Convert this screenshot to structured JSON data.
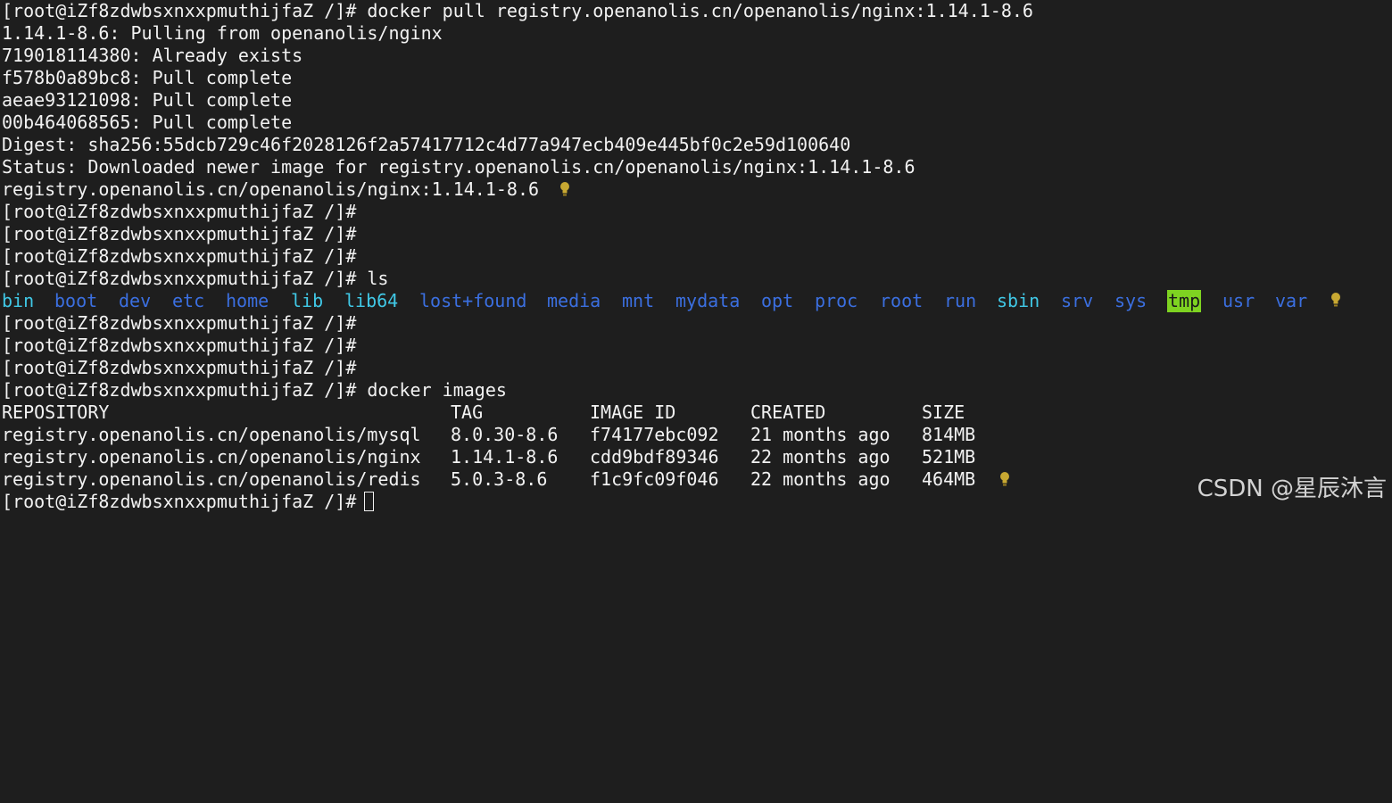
{
  "terminal": {
    "lines": [
      "[root@iZf8zdwbsxnxxpmuthijfaZ /]# docker pull registry.openanolis.cn/openanolis/nginx:1.14.1-8.6",
      "1.14.1-8.6: Pulling from openanolis/nginx",
      "719018114380: Already exists",
      "f578b0a89bc8: Pull complete",
      "aeae93121098: Pull complete",
      "00b464068565: Pull complete",
      "Digest: sha256:55dcb729c46f2028126f2a57417712c4d77a947ecb409e445bf0c2e59d100640",
      "Status: Downloaded newer image for registry.openanolis.cn/openanolis/nginx:1.14.1-8.6",
      "registry.openanolis.cn/openanolis/nginx:1.14.1-8.6",
      "[root@iZf8zdwbsxnxxpmuthijfaZ /]#",
      "[root@iZf8zdwbsxnxxpmuthijfaZ /]#",
      "[root@iZf8zdwbsxnxxpmuthijfaZ /]#",
      "[root@iZf8zdwbsxnxxpmuthijfaZ /]# ls"
    ],
    "ls_entries": [
      {
        "name": "bin",
        "color": "#40c8e6",
        "highlight": false
      },
      {
        "name": "boot",
        "color": "#3b6fe0",
        "highlight": false
      },
      {
        "name": "dev",
        "color": "#3b6fe0",
        "highlight": false
      },
      {
        "name": "etc",
        "color": "#3b6fe0",
        "highlight": false
      },
      {
        "name": "home",
        "color": "#3b6fe0",
        "highlight": false
      },
      {
        "name": "lib",
        "color": "#40c8e6",
        "highlight": false
      },
      {
        "name": "lib64",
        "color": "#40c8e6",
        "highlight": false
      },
      {
        "name": "lost+found",
        "color": "#3b6fe0",
        "highlight": false
      },
      {
        "name": "media",
        "color": "#3b6fe0",
        "highlight": false
      },
      {
        "name": "mnt",
        "color": "#3b6fe0",
        "highlight": false
      },
      {
        "name": "mydata",
        "color": "#3b6fe0",
        "highlight": false
      },
      {
        "name": "opt",
        "color": "#3b6fe0",
        "highlight": false
      },
      {
        "name": "proc",
        "color": "#3b6fe0",
        "highlight": false
      },
      {
        "name": "root",
        "color": "#3b6fe0",
        "highlight": false
      },
      {
        "name": "run",
        "color": "#3b6fe0",
        "highlight": false
      },
      {
        "name": "sbin",
        "color": "#40c8e6",
        "highlight": false
      },
      {
        "name": "srv",
        "color": "#3b6fe0",
        "highlight": false
      },
      {
        "name": "sys",
        "color": "#3b6fe0",
        "highlight": false
      },
      {
        "name": "tmp",
        "color": "#1a1a1a",
        "highlight": true
      },
      {
        "name": "usr",
        "color": "#3b6fe0",
        "highlight": false
      },
      {
        "name": "var",
        "color": "#3b6fe0",
        "highlight": false
      }
    ],
    "after_ls_lines": [
      "[root@iZf8zdwbsxnxxpmuthijfaZ /]#",
      "[root@iZf8zdwbsxnxxpmuthijfaZ /]#",
      "[root@iZf8zdwbsxnxxpmuthijfaZ /]#",
      "[root@iZf8zdwbsxnxxpmuthijfaZ /]# docker images"
    ],
    "images_table": {
      "headers": [
        "REPOSITORY",
        "TAG",
        "IMAGE ID",
        "CREATED",
        "SIZE"
      ],
      "rows": [
        [
          "registry.openanolis.cn/openanolis/mysql",
          "8.0.30-8.6",
          "f74177ebc092",
          "21 months ago",
          "814MB"
        ],
        [
          "registry.openanolis.cn/openanolis/nginx",
          "1.14.1-8.6",
          "cdd9bdf89346",
          "22 months ago",
          "521MB"
        ],
        [
          "registry.openanolis.cn/openanolis/redis",
          "5.0.3-8.6",
          "f1c9fc09f046",
          "22 months ago",
          "464MB"
        ]
      ]
    },
    "final_prompt": "[root@iZf8zdwbsxnxxpmuthijfaZ /]#",
    "icons": [
      "lightbulb-icon",
      "cursor-block"
    ],
    "colors": {
      "background": "#1e1e1e",
      "text": "#f2f2f2",
      "dir_blue": "#3b6fe0",
      "dir_cyan": "#40c8e6",
      "tmp_highlight": "#7ed321",
      "bulb": "#c8a832"
    }
  },
  "watermark": "CSDN @星辰沐言"
}
